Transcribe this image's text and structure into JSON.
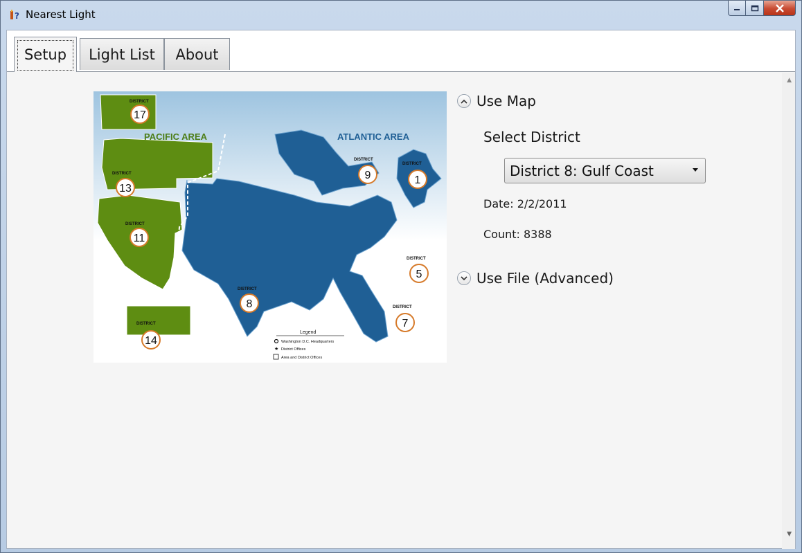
{
  "window": {
    "title": "Nearest Light"
  },
  "tabs": [
    {
      "label": "Setup"
    },
    {
      "label": "Light List"
    },
    {
      "label": "About"
    }
  ],
  "setup": {
    "use_map": {
      "label": "Use Map",
      "select_label": "Select District",
      "district_selected": "District 8: Gulf Coast",
      "date": "Date: 2/2/2011",
      "count": "Count: 8388"
    },
    "use_file": {
      "label": "Use File (Advanced)"
    }
  },
  "map": {
    "pacific_area": "PACIFIC AREA",
    "atlantic_area": "ATLANTIC AREA",
    "district_word": "DISTRICT",
    "districts": [
      "17",
      "13",
      "11",
      "14",
      "9",
      "1",
      "5",
      "7",
      "8"
    ],
    "legend": {
      "title": "Legend",
      "items": [
        "Washington D.C. Headquarters",
        "District Offices",
        "Area and District Offices"
      ]
    },
    "colors": {
      "pacific": "#5e8d12",
      "atlantic": "#1f5f95",
      "circle": "#d67a2a"
    }
  }
}
